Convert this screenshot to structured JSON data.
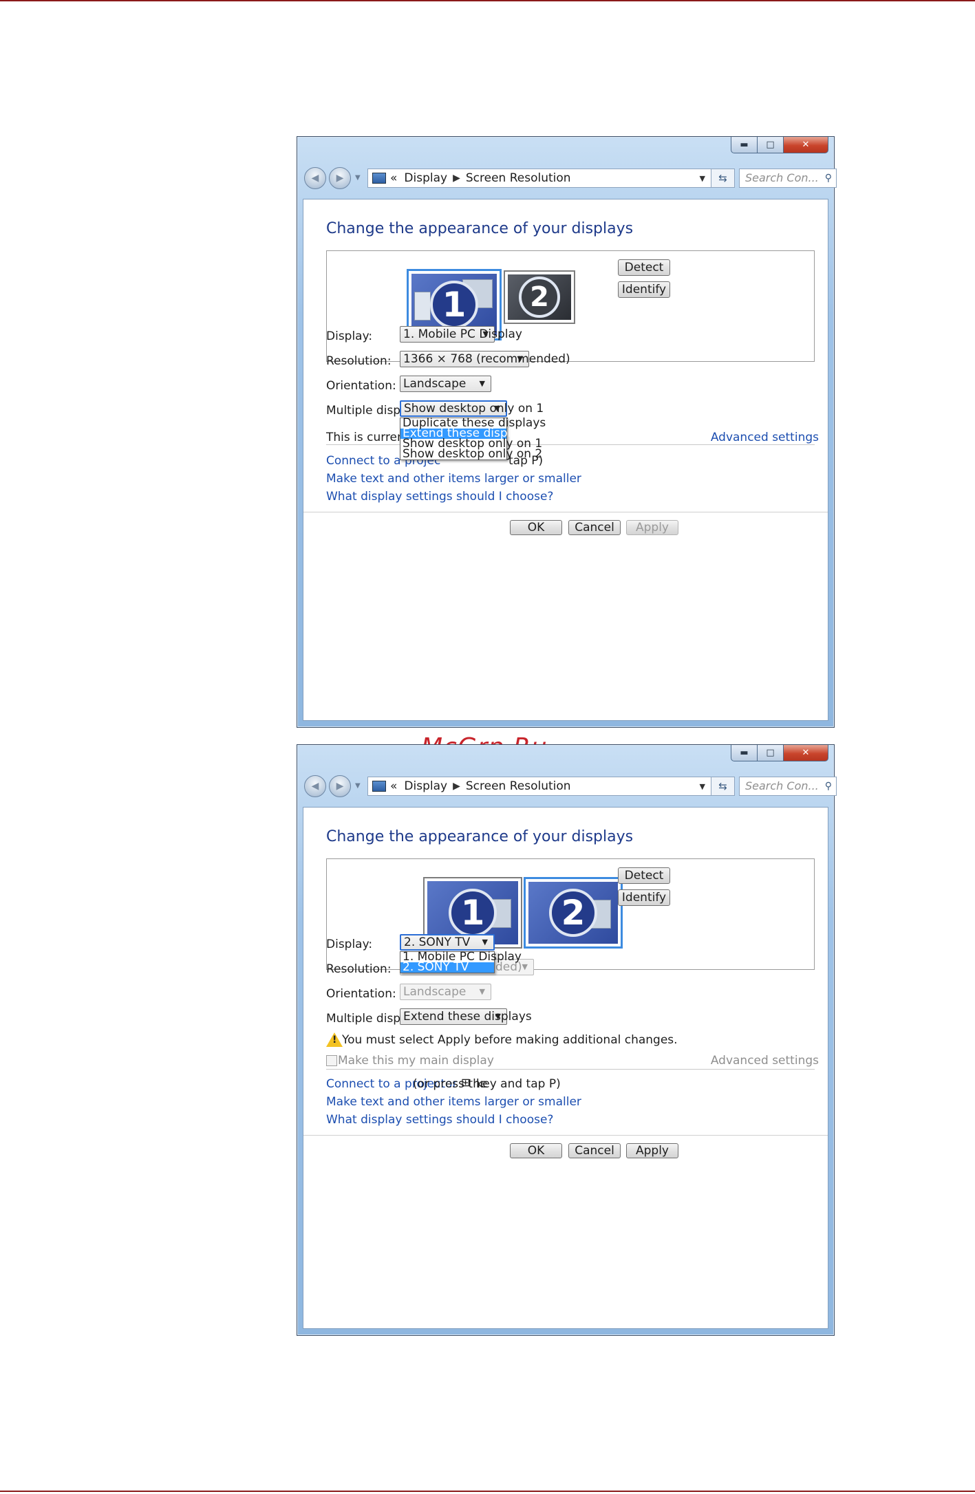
{
  "watermark": "McGrp.Ru",
  "window1": {
    "breadcrumb": [
      "Display",
      "Screen Resolution"
    ],
    "breadcrumb_prefix": "«",
    "search_placeholder": "Search Con...",
    "heading": "Change the appearance of your displays",
    "monitors": [
      "1",
      "2"
    ],
    "detect_label": "Detect",
    "identify_label": "Identify",
    "display_label": "Display:",
    "display_value": "1. Mobile PC Display",
    "resolution_label": "Resolution:",
    "resolution_value": "1366 × 768 (recommended)",
    "orientation_label": "Orientation:",
    "orientation_value": "Landscape",
    "multiple_label": "Multiple displays:",
    "multiple_value": "Show desktop only on 1",
    "multiple_options": [
      "Duplicate these displays",
      "Extend these displays",
      "Show desktop only on 1",
      "Show desktop only on 2"
    ],
    "multiple_highlighted": "Extend these displays",
    "status_text": "This is currently you",
    "advanced_settings": "Advanced settings",
    "link_projector": "Connect to a projec",
    "link_projector_tail": "tap P)",
    "link_text_size": "Make text and other items larger or smaller",
    "link_what_settings": "What display settings should I choose?",
    "ok_label": "OK",
    "cancel_label": "Cancel",
    "apply_label": "Apply"
  },
  "window2": {
    "breadcrumb": [
      "Display",
      "Screen Resolution"
    ],
    "breadcrumb_prefix": "«",
    "search_placeholder": "Search Con...",
    "heading": "Change the appearance of your displays",
    "monitors": [
      "1",
      "2"
    ],
    "detect_label": "Detect",
    "identify_label": "Identify",
    "display_label": "Display:",
    "display_value": "2. SONY TV",
    "display_options": [
      "1. Mobile PC Display",
      "2. SONY TV"
    ],
    "display_highlighted": "2. SONY TV",
    "resolution_label": "Resolution:",
    "resolution_value_tail": "ded)",
    "orientation_label": "Orientation:",
    "orientation_value": "Landscape",
    "multiple_label": "Multiple displays:",
    "multiple_value": "Extend these displays",
    "warning_text": "You must select Apply before making additional changes.",
    "main_display_label": "Make this my main display",
    "advanced_settings": "Advanced settings",
    "link_projector": "Connect to a projector",
    "projector_hint_pre": "(or press the",
    "projector_hint_post": "key and tap P)",
    "link_text_size": "Make text and other items larger or smaller",
    "link_what_settings": "What display settings should I choose?",
    "ok_label": "OK",
    "cancel_label": "Cancel",
    "apply_label": "Apply"
  }
}
